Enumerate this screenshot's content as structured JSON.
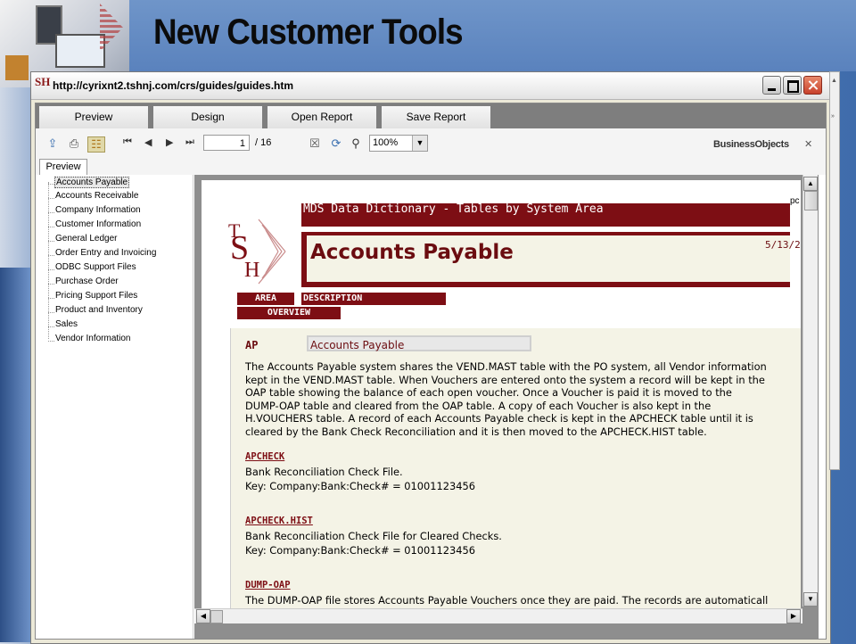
{
  "slide": {
    "title": "New Customer Tools"
  },
  "window": {
    "url": "http://cyrixnt2.tshnj.com/crs/guides/guides.htm",
    "icon_text": "SH"
  },
  "tabs": [
    "Preview",
    "Design",
    "Open Report",
    "Save Report"
  ],
  "toolbar": {
    "page_current": "1",
    "page_total": "/ 16",
    "zoom": "100%",
    "brand": "BusinessObjects",
    "close_glyph": "✕"
  },
  "preview_tab": "Preview",
  "tree": {
    "items": [
      "Accounts Payable",
      "Accounts Receivable",
      "Company Information",
      "Customer Information",
      "General Ledger",
      "Order Entry and Invoicing",
      "ODBC Support Files",
      "Purchase Order",
      "Pricing Support Files",
      "Product and Inventory",
      "Sales",
      "Vendor Information"
    ],
    "selected_index": 0
  },
  "report": {
    "header": "MDS Data Dictionary - Tables by System Area",
    "corner_text": "pc",
    "title": "Accounts Payable",
    "date": "5/13/2(",
    "col_area": "AREA",
    "col_description": "DESCRIPTION",
    "col_overview": "OVERVIEW",
    "area_code": "AP",
    "area_name": "Accounts Payable",
    "overview_lines": [
      "The Accounts Payable system shares the VEND.MAST table with the PO system, all Vendor information",
      "kept in the VEND.MAST table.  When Vouchers are entered onto the system a record will be kept in the",
      "OAP table showing the balance of each open voucher. Once a Voucher is paid it is moved to the",
      "DUMP-OAP table and cleared from the OAP table. A copy of each Voucher is also kept in the",
      "H.VOUCHERS table. A record of each Accounts Payable check is kept in the APCHECK table until it is",
      "cleared by the Bank Check Reconciliation and it is then moved to the APCHECK.HIST table."
    ],
    "tables": [
      {
        "name": "APCHECK",
        "lines": [
          "Bank Reconciliation Check File.",
          "Key: Company:Bank:Check# = 01001123456"
        ]
      },
      {
        "name": "APCHECK.HIST",
        "lines": [
          "Bank Reconciliation Check File for Cleared Checks.",
          "Key: Company:Bank:Check# = 01001123456"
        ]
      },
      {
        "name": "DUMP-OAP",
        "lines": [
          "The DUMP-OAP file stores Accounts Payable Vouchers once they are paid. The records are automaticall"
        ]
      }
    ]
  },
  "colors": {
    "report_maroon": "#7d0e14",
    "report_bg": "#f4f3e6",
    "tab_bar": "#7e7e7e"
  }
}
